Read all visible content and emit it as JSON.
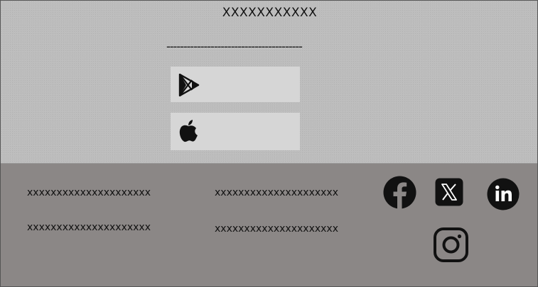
{
  "header": {
    "title": "XXXXXXXXXXX",
    "divider": "----------------------------------------"
  },
  "store_buttons": [
    {
      "icon": "google-play-icon"
    },
    {
      "icon": "apple-icon"
    }
  ],
  "footer": {
    "links": [
      "xxxxxxxxxxxxxxxxxxxxx",
      "xxxxxxxxxxxxxxxxxxxxx",
      "xxxxxxxxxxxxxxxxxxxxx",
      "xxxxxxxxxxxxxxxxxxxxx"
    ],
    "social_icons": [
      "facebook-icon",
      "x-icon",
      "linkedin-icon",
      "instagram-icon"
    ]
  },
  "colors": {
    "top_background": "#bdbdbd",
    "footer_background": "#8b8786",
    "button_background": "#d6d6d6",
    "icon_color": "#111111"
  }
}
